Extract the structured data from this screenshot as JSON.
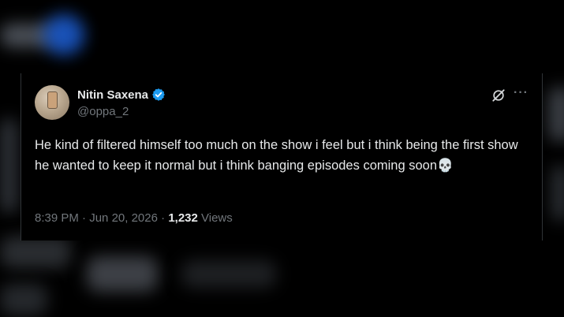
{
  "tweet": {
    "display_name": "Nitin Saxena",
    "handle": "@oppa_2",
    "text": "He kind of filtered himself too much on the show i feel but i think being the first show he wanted to keep it normal but i think banging episodes coming soon💀",
    "time": "8:39 PM",
    "separator": " · ",
    "date": "Jun 20, 2026",
    "views_count": "1,232",
    "views_label": " Views",
    "verified": true
  },
  "icons": {
    "verified": "verified-badge-icon",
    "grok": "grok-icon",
    "more": "more-options-icon"
  },
  "colors": {
    "background": "#000000",
    "text_primary": "#e7e9ea",
    "text_secondary": "#71767b",
    "verified_blue": "#1d9bf0",
    "border": "#2f3336"
  }
}
